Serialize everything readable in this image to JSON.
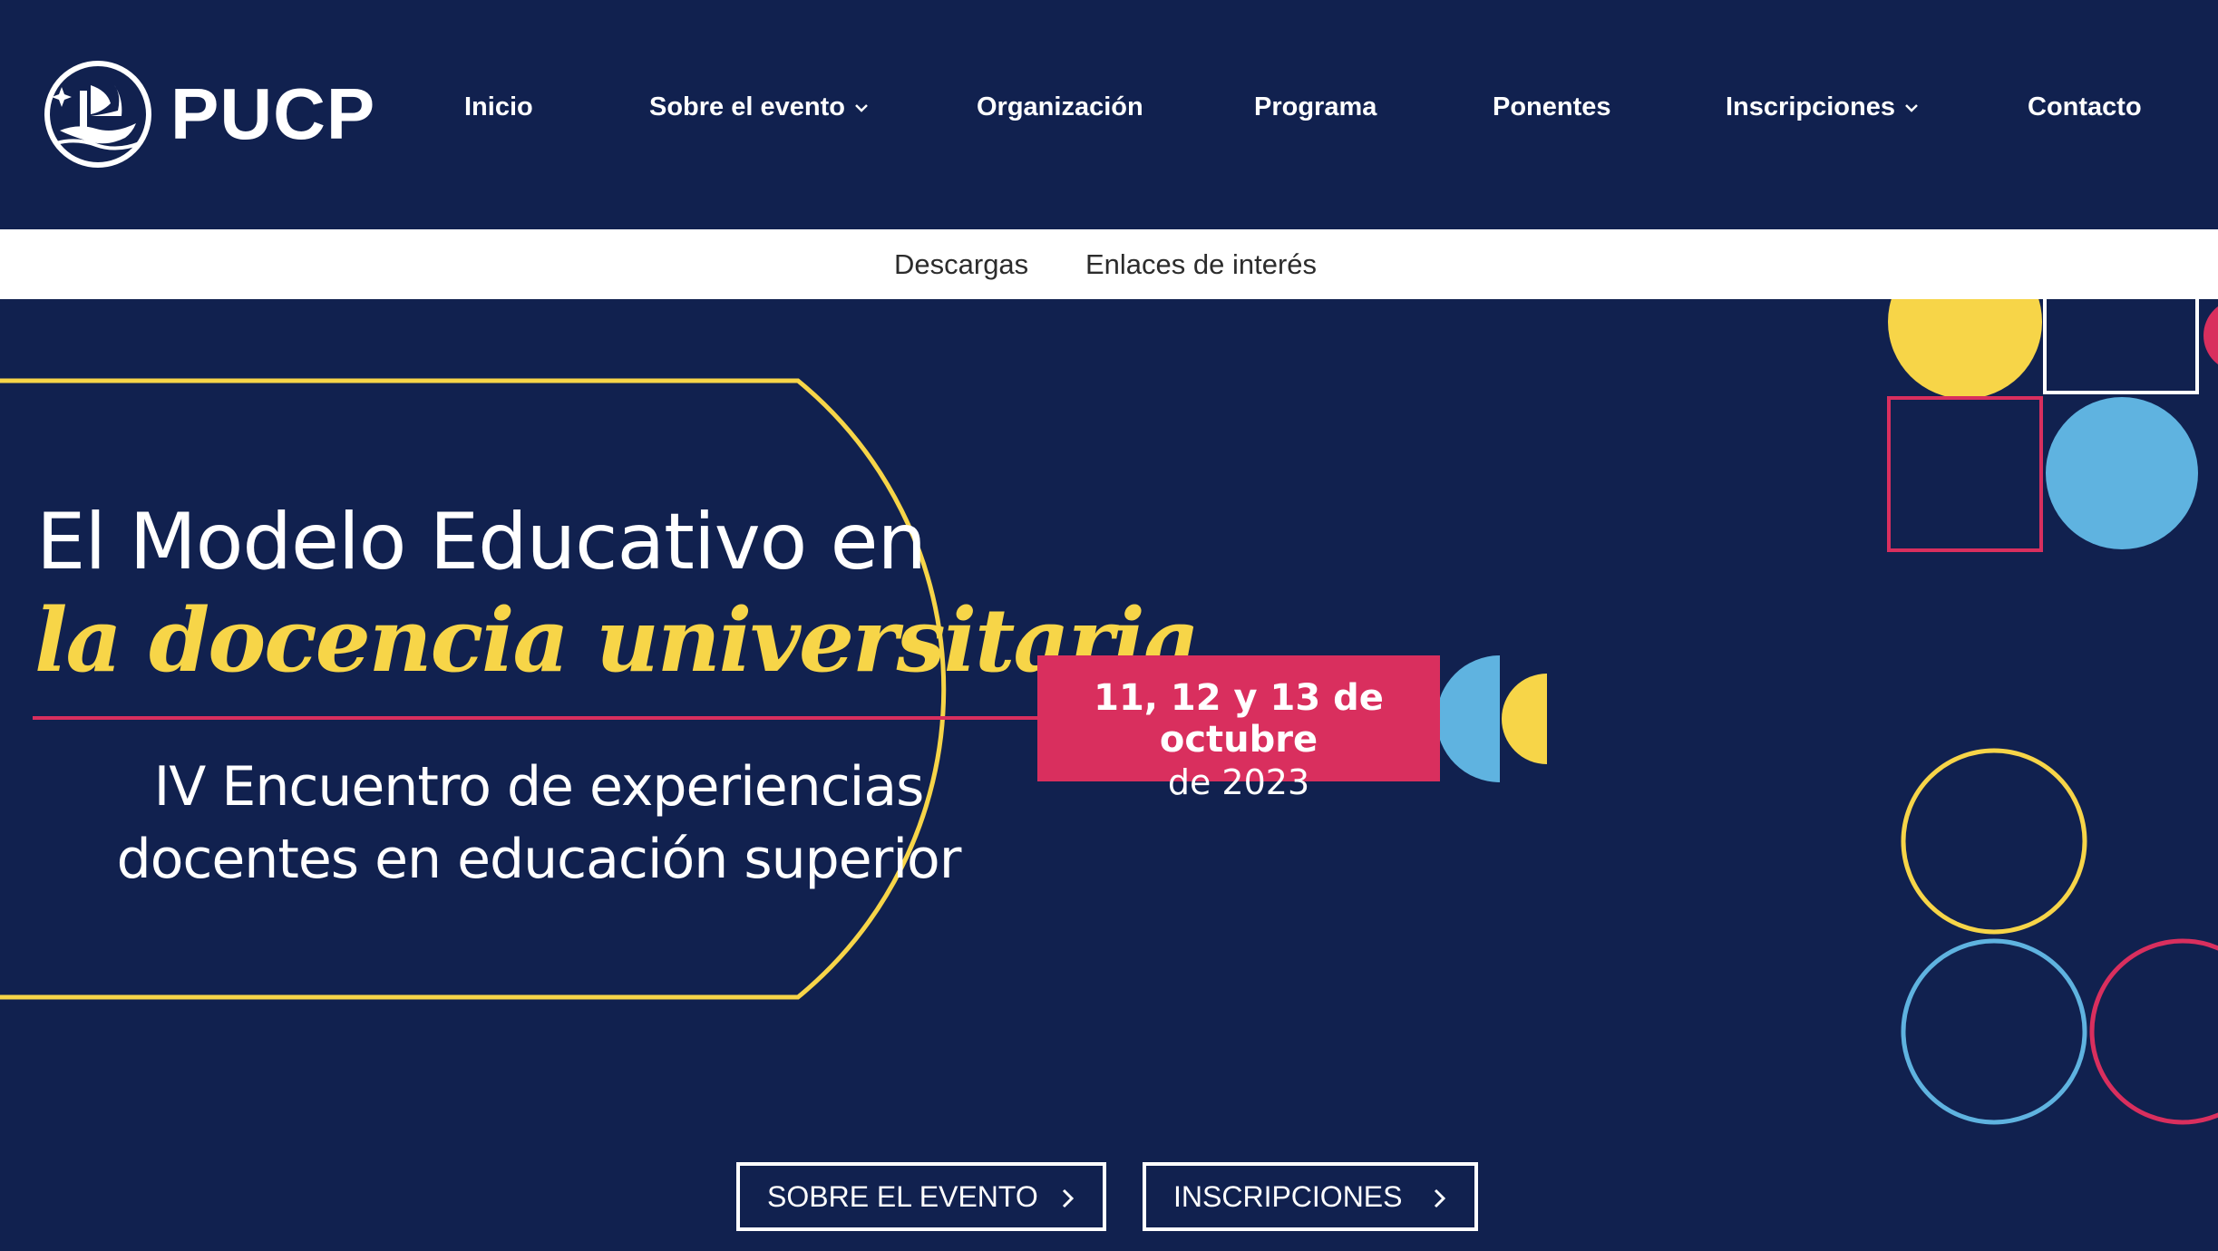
{
  "header": {
    "logo_text": "PUCP",
    "nav": [
      {
        "label": "Inicio",
        "has_dropdown": false
      },
      {
        "label": "Sobre el evento",
        "has_dropdown": true
      },
      {
        "label": "Organización",
        "has_dropdown": false
      },
      {
        "label": "Programa",
        "has_dropdown": false
      },
      {
        "label": "Ponentes",
        "has_dropdown": false
      },
      {
        "label": "Inscripciones",
        "has_dropdown": true
      },
      {
        "label": "Contacto",
        "has_dropdown": false
      }
    ]
  },
  "subnav": {
    "items": [
      {
        "label": "Descargas"
      },
      {
        "label": "Enlaces de interés"
      }
    ]
  },
  "hero": {
    "title_line1": "El Modelo Educativo en",
    "title_line2": "la docencia universitaria",
    "subtitle_line1": "IV Encuentro de experiencias",
    "subtitle_line2": "docentes en educación superior",
    "date_main": "11, 12 y 13 de octubre",
    "date_year": "de 2023"
  },
  "buttons": {
    "about": "SOBRE EL EVENTO",
    "register": "INSCRIPCIONES"
  },
  "colors": {
    "navy": "#11214f",
    "yellow": "#f7d548",
    "pink": "#d92f5e",
    "blue": "#5fb3e0",
    "white": "#ffffff"
  }
}
